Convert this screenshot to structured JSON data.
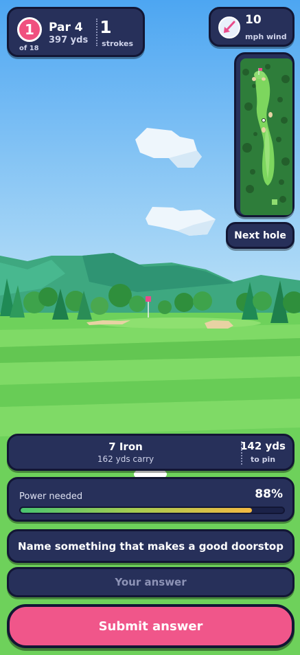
{
  "hole": {
    "number": "1",
    "of": "of 18",
    "par": "Par 4",
    "yards": "397 yds"
  },
  "strokes": {
    "count": "1",
    "label": "strokes"
  },
  "wind": {
    "speed": "10",
    "label": "mph wind",
    "icon": "wind-arrow-icon"
  },
  "minimap": {
    "icon": "course-map"
  },
  "next_hole": {
    "label": "Next hole"
  },
  "club": {
    "name": "7 Iron",
    "carry": "162 yds carry",
    "to_pin": "142 yds",
    "to_pin_label": "to pin"
  },
  "power": {
    "label": "Power needed",
    "value": "88%",
    "fraction": 0.88
  },
  "question": {
    "text": "Name something that makes a good doorstop"
  },
  "answer": {
    "placeholder": "Your answer",
    "value": ""
  },
  "submit": {
    "label": "Submit answer"
  },
  "colors": {
    "accent": "#f0568a",
    "panel": "#27305a",
    "outline": "#121634",
    "flag": "#e94b8a"
  }
}
